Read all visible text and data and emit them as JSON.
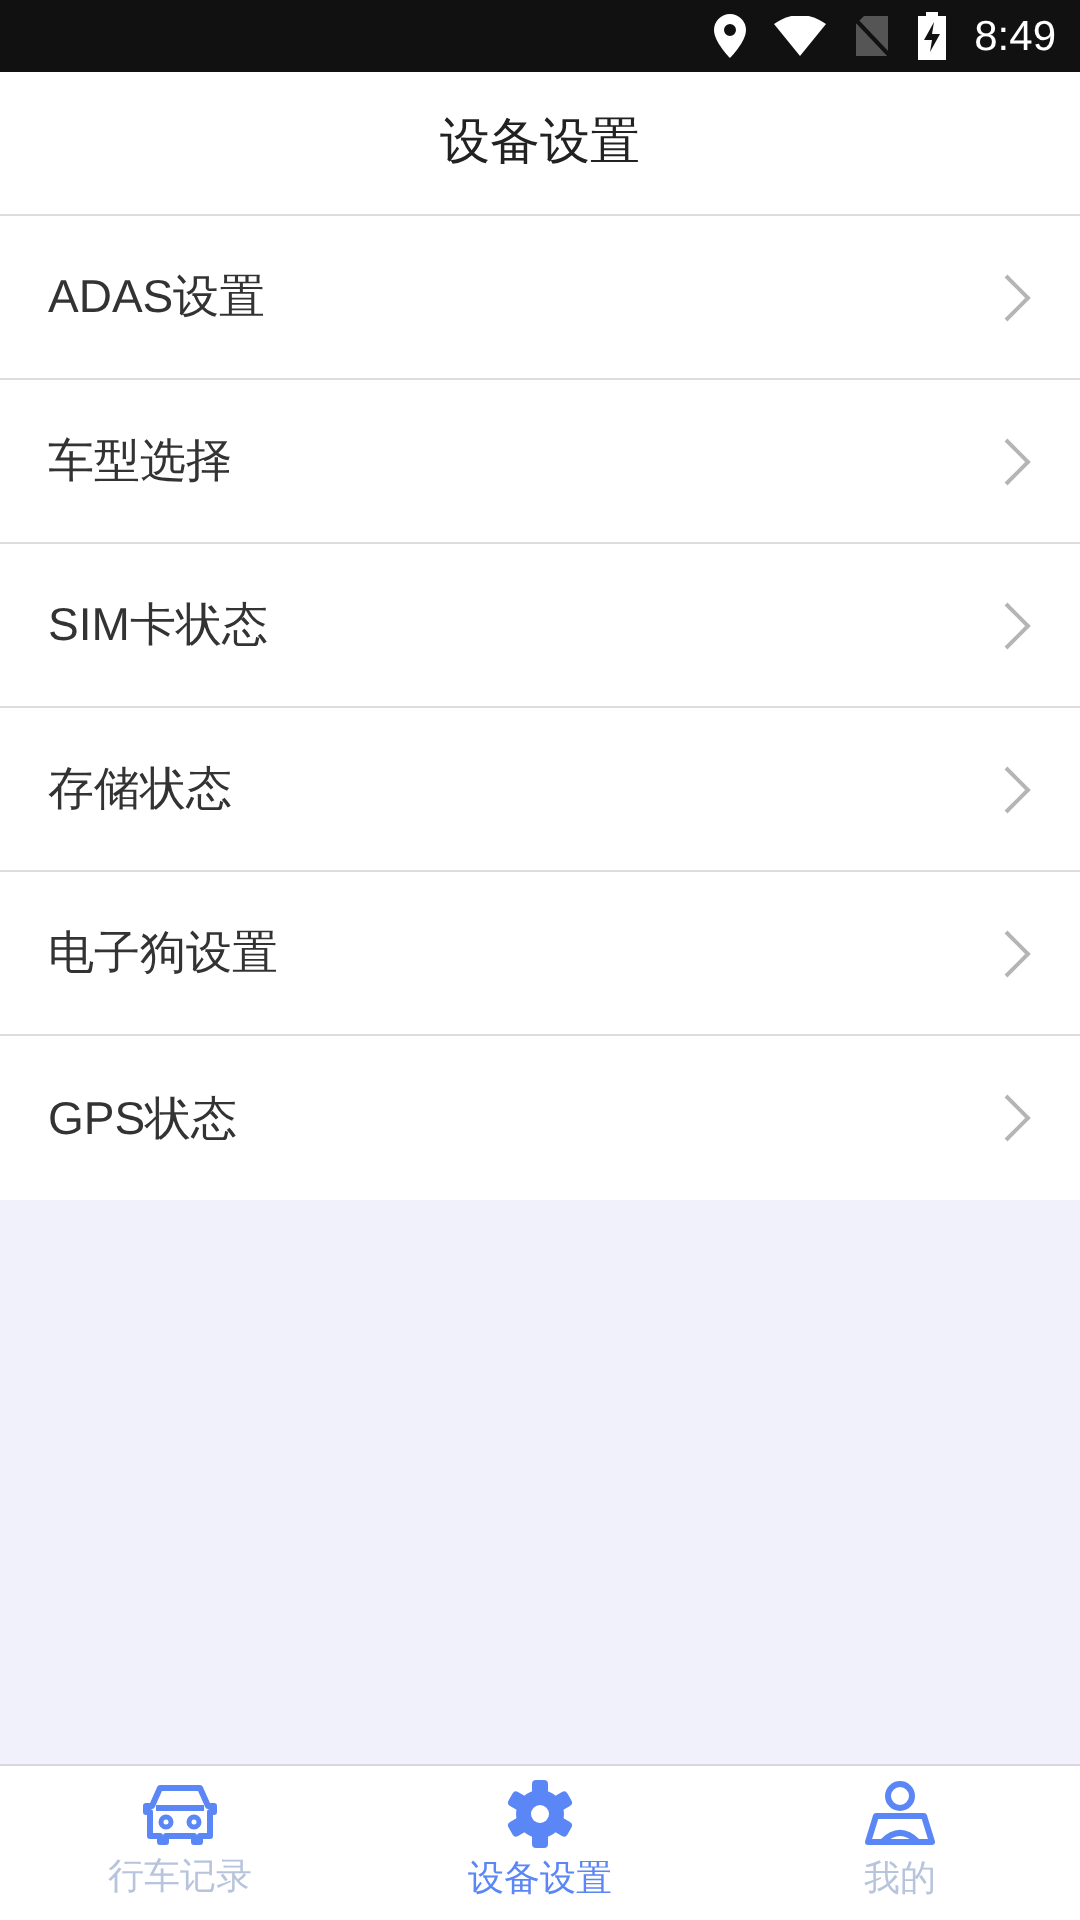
{
  "status_bar": {
    "time": "8:49"
  },
  "header": {
    "title": "设备设置"
  },
  "settings": [
    {
      "label": "ADAS设置"
    },
    {
      "label": "车型选择"
    },
    {
      "label": "SIM卡状态"
    },
    {
      "label": "存储状态"
    },
    {
      "label": "电子狗设置"
    },
    {
      "label": "GPS状态"
    }
  ],
  "tabs": [
    {
      "label": "行车记录",
      "selected": false
    },
    {
      "label": "设备设置",
      "selected": true
    },
    {
      "label": "我的",
      "selected": false
    }
  ]
}
